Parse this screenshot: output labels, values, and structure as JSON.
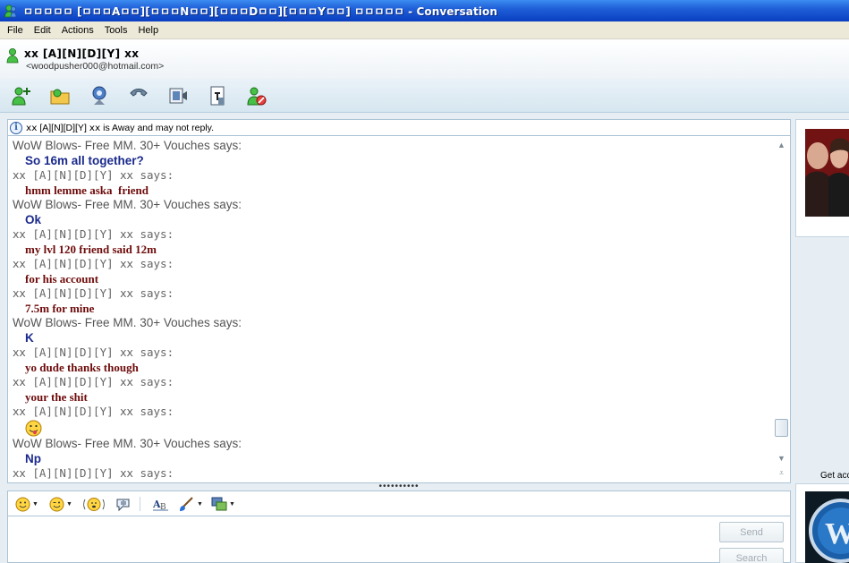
{
  "window": {
    "title": "ㅁㅁㅁㅁㅁ [ㅁㅁㅁAㅁㅁ][ㅁㅁㅁNㅁㅁ][ㅁㅁㅁDㅁㅁ][ㅁㅁㅁYㅁㅁ] ㅁㅁㅁㅁㅁ - Conversation"
  },
  "menu": [
    "File",
    "Edit",
    "Actions",
    "Tools",
    "Help"
  ],
  "contact": {
    "name": "ⅹⅹ [A][N][D][Y] ⅹⅹ",
    "email": "<woodpusher000@hotmail.com>"
  },
  "toolbar": {
    "icons": [
      "invite-contact-icon",
      "send-files-icon",
      "webcam-icon",
      "call-icon",
      "video-icon",
      "games-icon",
      "block-icon"
    ]
  },
  "infobar": {
    "text": "ⅹⅹ [A][N][D][Y] ⅹⅹ is Away and may not reply."
  },
  "conversation": {
    "lines": [
      {
        "kind": "says",
        "who": "wow",
        "text": "WoW Blows- Free MM. 30+ Vouches says:"
      },
      {
        "kind": "msg",
        "color": "blue",
        "text": "So 16m all together?"
      },
      {
        "kind": "says",
        "who": "andy",
        "text": "ⅹⅹ [A][N][D][Y] ⅹⅹ says:"
      },
      {
        "kind": "msg",
        "color": "red",
        "text": "hmm lemme aska  friend"
      },
      {
        "kind": "says",
        "who": "wow",
        "text": "WoW Blows- Free MM. 30+ Vouches says:"
      },
      {
        "kind": "msg",
        "color": "blue",
        "text": "Ok"
      },
      {
        "kind": "says",
        "who": "andy",
        "text": "ⅹⅹ [A][N][D][Y] ⅹⅹ says:"
      },
      {
        "kind": "msg",
        "color": "red",
        "text": "my lvl 120 friend said 12m"
      },
      {
        "kind": "says",
        "who": "andy",
        "text": "ⅹⅹ [A][N][D][Y] ⅹⅹ says:"
      },
      {
        "kind": "msg",
        "color": "red",
        "text": "for his account"
      },
      {
        "kind": "says",
        "who": "andy",
        "text": "ⅹⅹ [A][N][D][Y] ⅹⅹ says:"
      },
      {
        "kind": "msg",
        "color": "red",
        "text": "7.5m for mine"
      },
      {
        "kind": "says",
        "who": "wow",
        "text": "WoW Blows- Free MM. 30+ Vouches says:"
      },
      {
        "kind": "msg",
        "color": "blue",
        "text": "K"
      },
      {
        "kind": "says",
        "who": "andy",
        "text": "ⅹⅹ [A][N][D][Y] ⅹⅹ says:"
      },
      {
        "kind": "msg",
        "color": "red",
        "text": "yo dude thanks though"
      },
      {
        "kind": "says",
        "who": "andy",
        "text": "ⅹⅹ [A][N][D][Y] ⅹⅹ says:"
      },
      {
        "kind": "msg",
        "color": "red",
        "text": "your the shit"
      },
      {
        "kind": "says",
        "who": "andy",
        "text": "ⅹⅹ [A][N][D][Y] ⅹⅹ says:"
      },
      {
        "kind": "emote",
        "icon": "tongue-out-emoticon-icon"
      },
      {
        "kind": "says",
        "who": "wow",
        "text": "WoW Blows- Free MM. 30+ Vouches says:"
      },
      {
        "kind": "msg",
        "color": "blue",
        "text": "Np"
      },
      {
        "kind": "says",
        "who": "andy",
        "text": "ⅹⅹ [A][N][D][Y] ⅹⅹ says:"
      }
    ]
  },
  "format_toolbar": {
    "icons": [
      "emoticon-icon",
      "wink-icon",
      "nudge-icon",
      "voice-clip-icon",
      "font-icon",
      "background-icon",
      "display-picture-icon"
    ]
  },
  "input": {
    "send_label": "Send",
    "search_label": "Search"
  },
  "right_pane": {
    "label": "Get acco"
  },
  "colors": {
    "blue_text": "#1a2a8c",
    "red_text": "#6e0b0b",
    "title_bar": "#1f5fd8"
  }
}
